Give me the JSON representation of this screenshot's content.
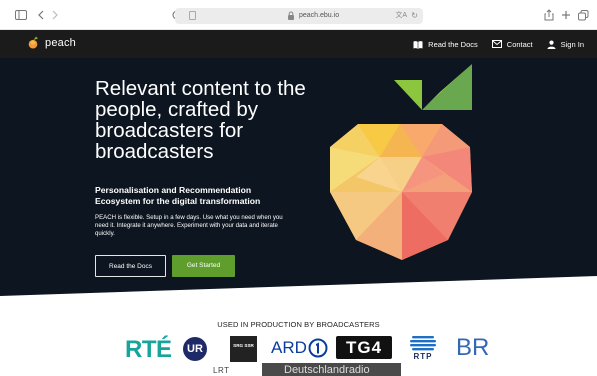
{
  "browser": {
    "url_host": "peach.ebu.io"
  },
  "nav": {
    "brand": "peach",
    "links": [
      {
        "label": "Read the Docs",
        "icon": "docs-icon"
      },
      {
        "label": "Contact",
        "icon": "mail-icon"
      },
      {
        "label": "Sign In",
        "icon": "user-icon"
      }
    ]
  },
  "hero": {
    "headline": "Relevant content to the people, crafted by broadcasters for broadcasters",
    "subheadline": "Personalisation and Recommendation Ecosystem for the digital transformation",
    "description": "PEACH is flexible. Setup in a few days. Use what you need when you need it. Integrate it anywhere. Experiment with your data and iterate quickly.",
    "docs_button": "Read the Docs",
    "start_button": "Get Started"
  },
  "production": {
    "title": "USED IN PRODUCTION BY BROADCASTERS",
    "logos": [
      {
        "name": "RTÉ"
      },
      {
        "name": "UR"
      },
      {
        "name": "SRG SSR"
      },
      {
        "name": "ARD"
      },
      {
        "name": "TG4"
      },
      {
        "name": "RTP"
      },
      {
        "name": "BR"
      },
      {
        "name": "LRT"
      },
      {
        "name": "Deutschlandradio"
      }
    ]
  },
  "colors": {
    "nav_bg": "#1b1b1b",
    "hero_bg": "#0c1520",
    "accent_green": "#5f9e2c",
    "rte_green": "#17a59b",
    "ard_blue": "#0b3c9c",
    "br_blue": "#3467b6"
  }
}
